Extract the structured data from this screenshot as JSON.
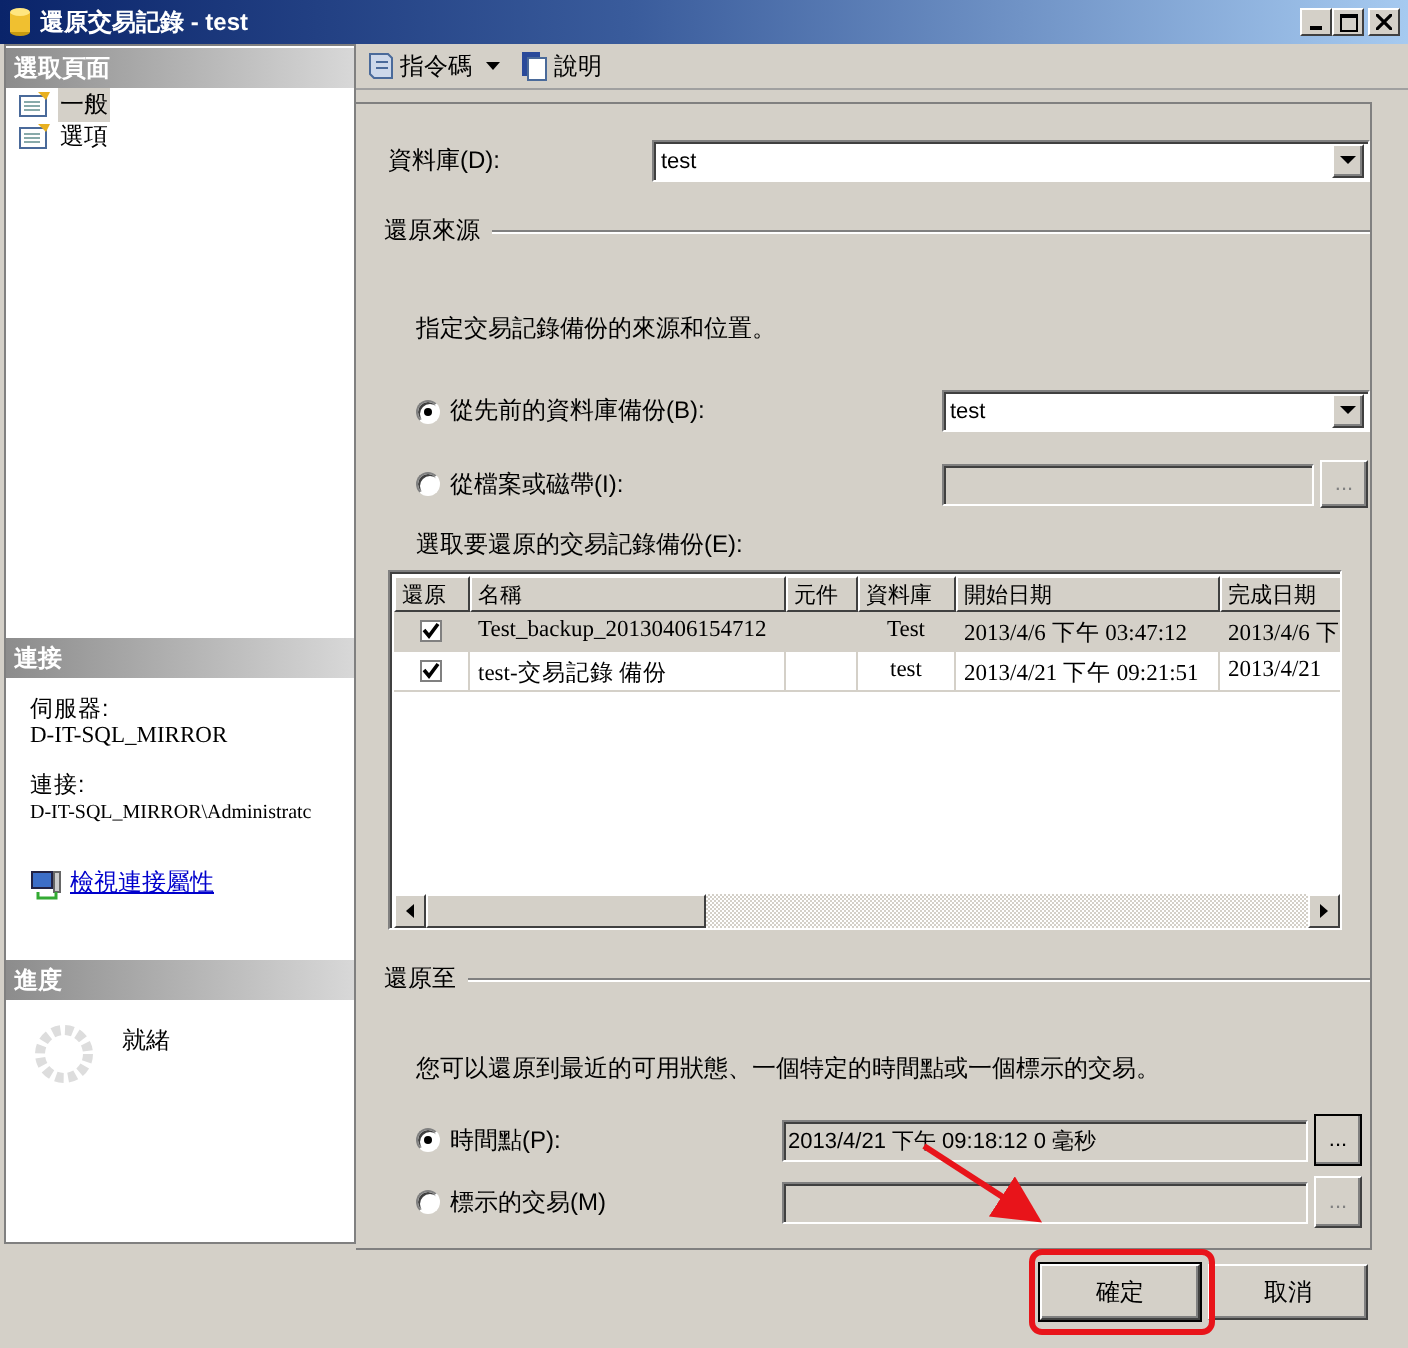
{
  "window": {
    "title": "還原交易記錄 - test"
  },
  "sidebar": {
    "pages_header": "選取頁面",
    "pages": [
      {
        "label": "一般",
        "selected": true
      },
      {
        "label": "選項",
        "selected": false
      }
    ],
    "connection_header": "連接",
    "server_label": "伺服器:",
    "server": "D-IT-SQL_MIRROR",
    "connection_label": "連接:",
    "connection": "D-IT-SQL_MIRROR\\Administratc",
    "link": "檢視連接屬性",
    "progress_header": "進度",
    "progress_status": "就緒"
  },
  "toolbar": [
    {
      "label": "指令碼",
      "kind": "script"
    },
    {
      "label": "說明",
      "kind": "help"
    }
  ],
  "database": {
    "label": "資料庫(D):",
    "value": "test"
  },
  "source": {
    "heading": "還原來源",
    "description": "指定交易記錄備份的來源和位置。",
    "options": [
      {
        "label": "從先前的資料庫備份(B):",
        "selected": true,
        "kind": "dropdown",
        "value": "test"
      },
      {
        "label": "從檔案或磁帶(I):",
        "selected": false,
        "kind": "browse",
        "button": "..."
      }
    ],
    "table_label": "選取要還原的交易記錄備份(E):",
    "table": {
      "check_column": "還原",
      "columns": [
        "名稱",
        "元件",
        "資料庫",
        "開始日期",
        "完成日期"
      ],
      "rows": [
        {
          "checked": true,
          "selected": true,
          "cells": [
            "Test_backup_20130406154712",
            "",
            "Test",
            "2013/4/6 下午 03:47:12",
            "2013/4/6 下"
          ]
        },
        {
          "checked": true,
          "selected": false,
          "cells": [
            "test-交易記錄  備份",
            "",
            "test",
            "2013/4/21 下午 09:21:51",
            "2013/4/21"
          ]
        }
      ]
    }
  },
  "restore_to": {
    "heading": "還原至",
    "description": "您可以還原到最近的可用狀態、一個特定的時間點或一個標示的交易。",
    "options": [
      {
        "label": "時間點(P):",
        "selected": true,
        "value": "2013/4/21 下午 09:18:12 0 毫秒",
        "button": "..."
      },
      {
        "label": "標示的交易(M)",
        "selected": false,
        "button": "..."
      }
    ]
  },
  "buttons": [
    {
      "label": "確定",
      "default": true
    },
    {
      "label": "取消",
      "default": false
    }
  ]
}
